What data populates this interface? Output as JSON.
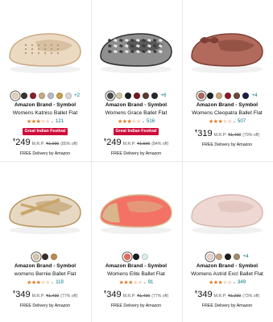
{
  "products": [
    {
      "brand": "Amazon Brand - Symbol",
      "title": "Womens Katniss Ballet Flat",
      "swatches": [
        "#e8d3b8",
        "#3b3330",
        "#8a1f2b",
        "#c8a987",
        "#b9b9c2",
        "#c7a24c",
        "#d9d9de"
      ],
      "more": "+2",
      "stars": "★★★",
      "stars_empty": "★★",
      "rating_count": "121",
      "deal": "Great Indian Festival",
      "currency": "₹",
      "price": "249",
      "mrp_label": "M.R.P:",
      "mrp": "₹1,999",
      "discount": "(85% off)",
      "delivery": "FREE Delivery by Amazon",
      "shoe_color": "#ecd9c2",
      "shoe_color_dark": "#c9ab88",
      "pattern": "perforated"
    },
    {
      "brand": "Amazon Brand - Symbol",
      "title": "Womens Grace Ballet Flat",
      "swatches": [
        "#4b4b4b",
        "#d8c6a8",
        "#1f1f1f",
        "#7a1620",
        "#5e3a2a",
        "#2b2b2b"
      ],
      "more": "+6",
      "stars": "★★★",
      "stars_empty": "★★",
      "rating_count": "516",
      "deal": "Great Indian Festival",
      "currency": "₹",
      "price": "249",
      "mrp_label": "M.R.P:",
      "mrp": "₹1,599",
      "discount": "(84% off)",
      "delivery": "FREE Delivery by Amazon",
      "shoe_color": "#8f8f8f",
      "shoe_color_dark": "#2f2f2f",
      "pattern": "snake"
    },
    {
      "brand": "Amazon Brand - Symbol",
      "title": "Womens Cleopatra Ballet Flat",
      "swatches": [
        "#b0685a",
        "#222222",
        "#c7a685",
        "#8b1d2a",
        "#6b4a37",
        "#1b2240"
      ],
      "more": "+4",
      "stars": "★★★",
      "stars_empty": "★★",
      "rating_count": "507",
      "deal": "",
      "currency": "₹",
      "price": "319",
      "mrp_label": "M.R.P:",
      "mrp": "₹1,499",
      "discount": "(79% off)",
      "delivery": "FREE Delivery by Amazon",
      "shoe_color": "#b26a5c",
      "shoe_color_dark": "#7e3f35",
      "pattern": "bow"
    },
    {
      "brand": "Amazon Brand - Symbol",
      "title": "womens Bernie Ballet Flat",
      "swatches": [
        "#d9c7a8",
        "#3a302b",
        "#b88d54"
      ],
      "more": "",
      "stars": "★★★",
      "stars_empty": "★★",
      "rating_count": "119",
      "deal": "",
      "currency": "₹",
      "price": "349",
      "mrp_label": "M.R.P:",
      "mrp": "₹1,499",
      "discount": "(77% off)",
      "delivery": "FREE Delivery by Amazon",
      "shoe_color": "#e6d8c2",
      "shoe_color_dark": "#b8965e",
      "pattern": "straps"
    },
    {
      "brand": "Amazon Brand - Symbol",
      "title": "Womens Elite Ballet Flat",
      "swatches": [
        "#f06a5b",
        "#1e1e1e",
        "#d9eee9"
      ],
      "more": "",
      "stars": "★★★",
      "stars_empty": "★★",
      "rating_count": "91",
      "deal": "",
      "currency": "₹",
      "price": "349",
      "mrp_label": "M.R.P:",
      "mrp": "₹1,499",
      "discount": "(77% off)",
      "delivery": "FREE Delivery by Amazon",
      "shoe_color": "#f37265",
      "shoe_color_dark": "#d9b68c",
      "pattern": "toecap"
    },
    {
      "brand": "Amazon Brand - Symbol",
      "title": "Womens Astrid Excl Ballet Flat",
      "swatches": [
        "#ecd6d0",
        "#c9a889",
        "#1e1e1e",
        "#a68b6e"
      ],
      "more": "+4",
      "stars": "★★★",
      "stars_empty": "★★",
      "rating_count": "349",
      "deal": "",
      "currency": "₹",
      "price": "349",
      "mrp_label": "M.R.P:",
      "mrp": "₹1,299",
      "discount": "(73% off)",
      "delivery": "FREE Delivery by Amazon",
      "shoe_color": "#efd8d3",
      "shoe_color_dark": "#d8b9b1",
      "pattern": "plain"
    }
  ]
}
